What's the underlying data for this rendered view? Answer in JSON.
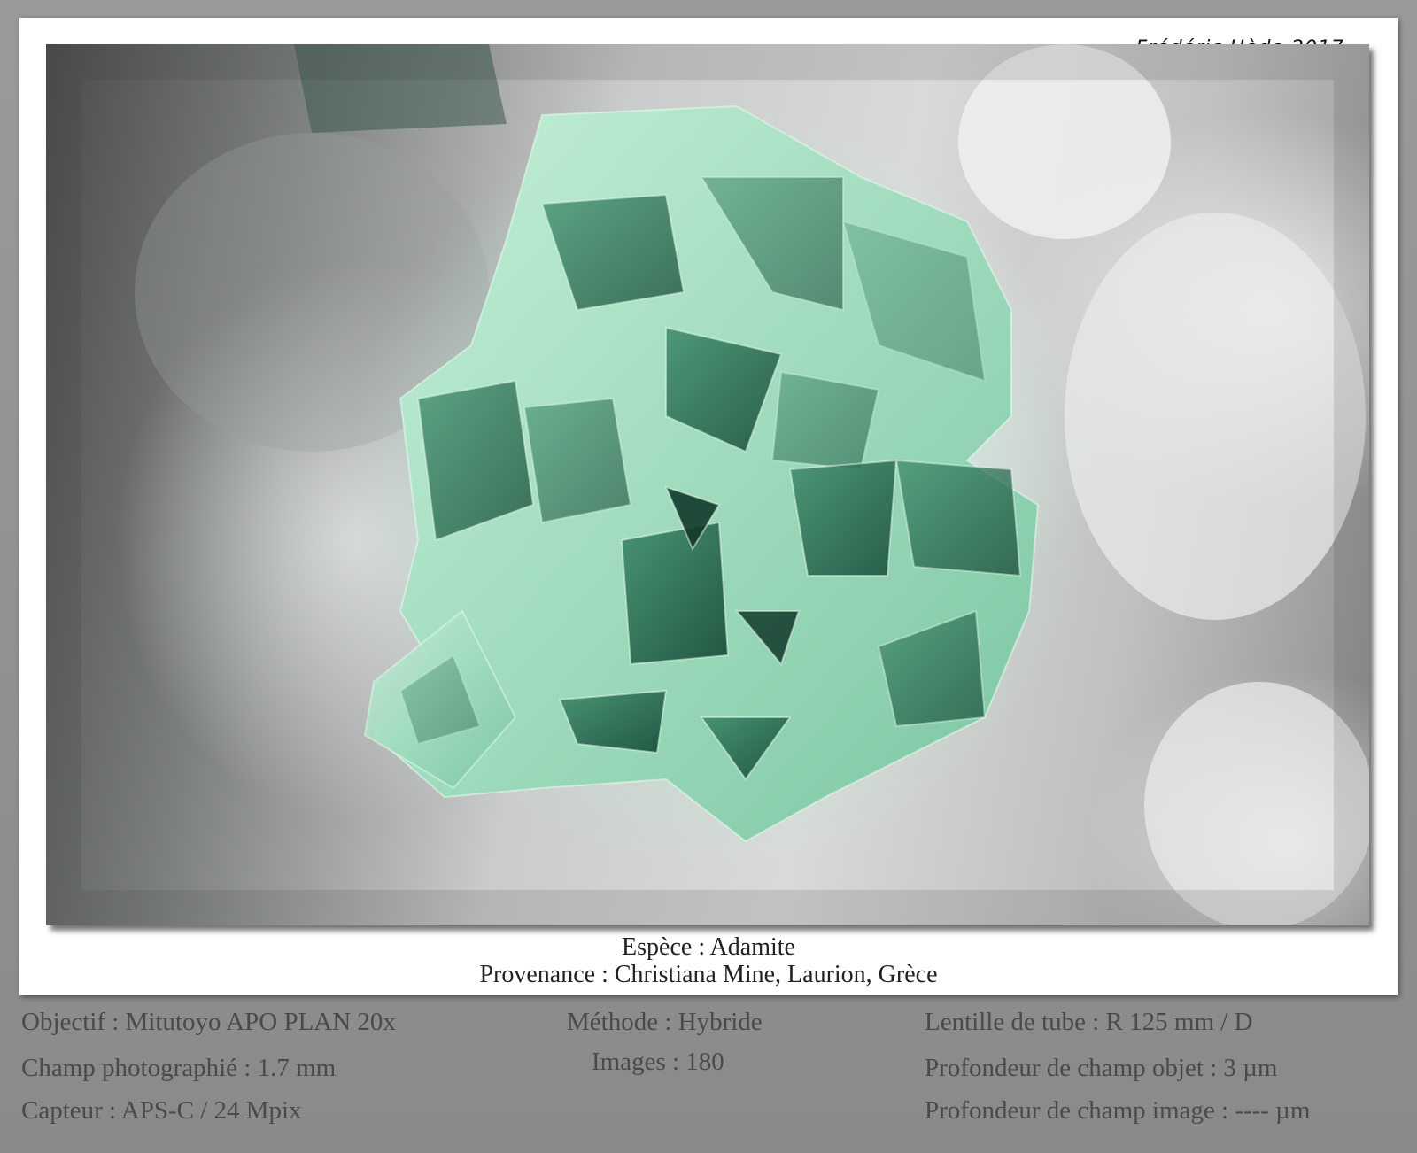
{
  "credit": "Frédéric Hède 2017",
  "caption": {
    "species": "Espèce : Adamite",
    "origin": "Provenance : Christiana Mine, Laurion, Grèce"
  },
  "technical": {
    "objective": "Objectif : Mitutoyo APO PLAN 20x",
    "field": "Champ photographié : 1.7 mm",
    "sensor": "Capteur : APS-C / 24 Mpix",
    "method": "Méthode : Hybride",
    "images": "Images : 180",
    "tube_lens": "Lentille de tube : R 125 mm / D",
    "dof_object": "Profondeur de champ objet : 3 µm",
    "dof_image": "Profondeur de champ image : ---- µm"
  },
  "colors": {
    "crystal_light": "#9fe0c0",
    "crystal_mid": "#5fae8a",
    "crystal_dark": "#1f5a44",
    "matrix": "#e6e8e8"
  }
}
